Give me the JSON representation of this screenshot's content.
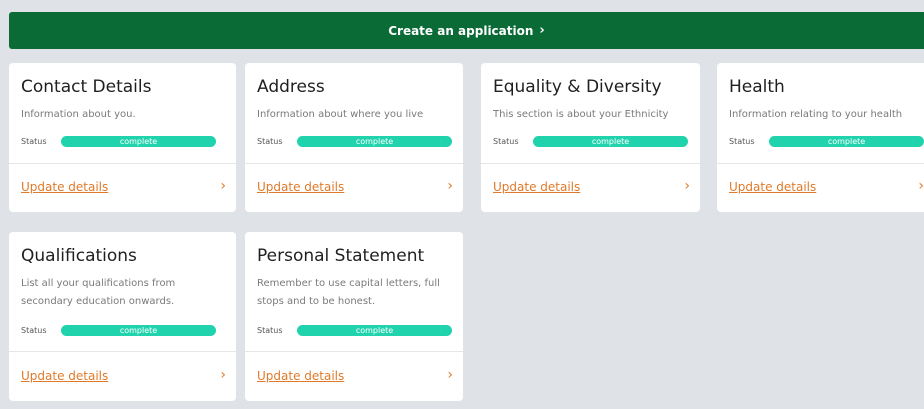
{
  "header": {
    "create_label": "Create an application",
    "create_chevron": "›"
  },
  "cards": [
    {
      "title": "Contact Details",
      "desc": "Information about you.",
      "status_label": "Status",
      "status": "complete",
      "action": "Update details",
      "arrow": "›"
    },
    {
      "title": "Address",
      "desc": "Information about where you live",
      "status_label": "Status",
      "status": "complete",
      "action": "Update details",
      "arrow": "›"
    },
    {
      "title": "Equality & Diversity",
      "desc": "This section is about your Ethnicity",
      "status_label": "Status",
      "status": "complete",
      "action": "Update details",
      "arrow": "›"
    },
    {
      "title": "Health",
      "desc": "Information relating to your health",
      "status_label": "Status",
      "status": "complete",
      "action": "Update details",
      "arrow": "›"
    },
    {
      "title": "Qualifications",
      "desc": "List all your qualifications from secondary education onwards.",
      "status_label": "Status",
      "status": "complete",
      "action": "Update details",
      "arrow": "›"
    },
    {
      "title": "Personal Statement",
      "desc": "Remember to use capital letters, full stops and to be honest.",
      "status_label": "Status",
      "status": "complete",
      "action": "Update details",
      "arrow": "›"
    }
  ],
  "colors": {
    "header_bg": "#0a6b36",
    "status_pill": "#20d3ad",
    "link": "#e07a2a",
    "page_bg": "#dfe3e8"
  },
  "icons": {
    "header_chevron": "chevron-right-icon",
    "card_arrow": "chevron-right-icon"
  }
}
